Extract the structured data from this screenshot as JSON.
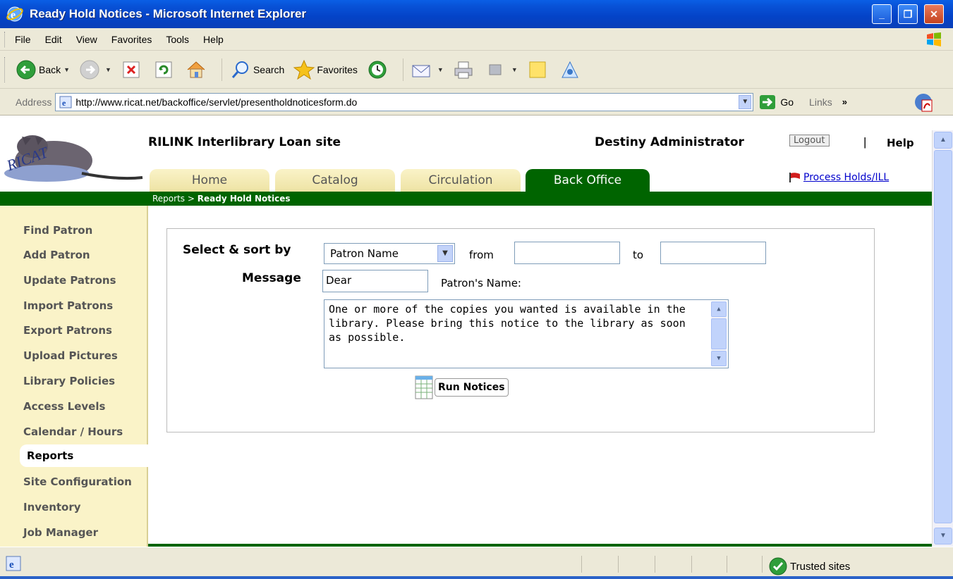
{
  "window": {
    "title": "Ready Hold Notices - Microsoft Internet Explorer",
    "controls": [
      "_",
      "❐",
      "✕"
    ]
  },
  "menubar": {
    "items": [
      "File",
      "Edit",
      "View",
      "Favorites",
      "Tools",
      "Help"
    ]
  },
  "toolbar": {
    "back_label": "Back",
    "search_label": "Search",
    "favorites_label": "Favorites"
  },
  "addressbar": {
    "label": "Address",
    "url": "http://www.ricat.net/backoffice/servlet/presentholdnoticesform.do",
    "go_label": "Go",
    "links_label": "Links"
  },
  "site": {
    "title": "RILINK Interlibrary Loan site",
    "user": "Destiny Administrator",
    "logout_label": "Logout",
    "separator": "|",
    "help_label": "Help",
    "logo_text": "RICAT",
    "process_holds_label": "Process Holds/ILL",
    "tabs": [
      {
        "label": "Home",
        "active": false
      },
      {
        "label": "Catalog",
        "active": false
      },
      {
        "label": "Circulation",
        "active": false
      },
      {
        "label": "Back Office",
        "active": true
      }
    ],
    "breadcrumb": {
      "parent": "Reports",
      "separator": ">",
      "current": "Ready Hold Notices"
    }
  },
  "sidebar": {
    "items": [
      {
        "label": "Find Patron"
      },
      {
        "label": "Add Patron"
      },
      {
        "label": "Update Patrons"
      },
      {
        "label": "Import Patrons"
      },
      {
        "label": "Export Patrons"
      },
      {
        "label": "Upload Pictures"
      },
      {
        "label": "Library Policies"
      },
      {
        "label": "Access Levels"
      },
      {
        "label": "Calendar / Hours"
      },
      {
        "label": "Reports",
        "active": true
      },
      {
        "label": "Site Configuration"
      },
      {
        "label": "Inventory"
      },
      {
        "label": "Job Manager"
      }
    ]
  },
  "form": {
    "select_label": "Select & sort by",
    "select_value": "Patron Name",
    "from_label": "from",
    "from_value": "",
    "to_label": "to",
    "to_value": "",
    "message_label": "Message",
    "message_value": "Dear",
    "patron_name_label": "Patron's Name:",
    "body_text": "One or more of the copies you wanted is available in the library. Please bring this notice to the library as soon as possible.",
    "run_button_label": "Run Notices"
  },
  "statusbar": {
    "zone_label": "Trusted sites"
  },
  "colors": {
    "xp_blue": "#0a5fe6",
    "chrome": "#ece9d8",
    "site_green": "#006400",
    "tab_cream": "#faf3c8",
    "link_blue": "#0000cc"
  }
}
